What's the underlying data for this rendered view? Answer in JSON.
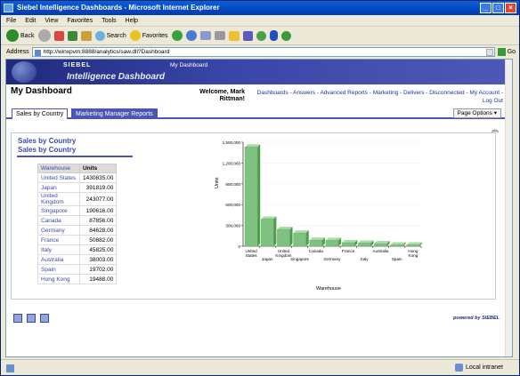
{
  "window": {
    "title": "Siebel Intelligence Dashboards - Microsoft Internet Explorer"
  },
  "menu": [
    "File",
    "Edit",
    "View",
    "Favorites",
    "Tools",
    "Help"
  ],
  "toolbar": {
    "back": "Back",
    "search": "Search",
    "favorites": "Favorites"
  },
  "address": {
    "label": "Address",
    "url": "http://winxpvm:8888/analytics/saw.dll?Dashboard",
    "go": "Go"
  },
  "banner": {
    "brand": "SIEBEL",
    "product": "Intelligence Dashboard",
    "link": "My Dashboard"
  },
  "header": {
    "title": "My Dashboard",
    "welcome_line1": "Welcome, Mark",
    "welcome_line2": "Rittman!",
    "nav_line1": "Dashboards - Answers - Advanced Reports - Marketing - Delivers - Disconnected - My Account -",
    "nav_line2": "Log Out"
  },
  "tabs": [
    "Sales by Country",
    "Marketing Manager Reports"
  ],
  "page_options": "Page Options",
  "report": {
    "title1": "Sales by Country",
    "title2": "Sales by Country",
    "table": {
      "headers": [
        "Warehouse",
        "Units"
      ],
      "rows": [
        [
          "United States",
          "1430835.00"
        ],
        [
          "Japan",
          "391819.00"
        ],
        [
          "United Kingdom",
          "243077.00"
        ],
        [
          "Singapore",
          "190616.00"
        ],
        [
          "Canada",
          "87856.00"
        ],
        [
          "Germany",
          "84628.00"
        ],
        [
          "France",
          "50882.00"
        ],
        [
          "Italy",
          "45825.00"
        ],
        [
          "Australia",
          "38003.00"
        ],
        [
          "Spain",
          "19702.00"
        ],
        [
          "Hong Kong",
          "19488.00"
        ]
      ]
    }
  },
  "chart_data": {
    "type": "bar",
    "categories": [
      "United States",
      "Japan",
      "United Kingdom",
      "Singapore",
      "Canada",
      "Germany",
      "France",
      "Italy",
      "Australia",
      "Spain",
      "Hong Kong"
    ],
    "values": [
      1430835,
      391819,
      243077,
      190616,
      87856,
      84628,
      50882,
      45825,
      38003,
      19702,
      19488
    ],
    "ylim": [
      0,
      1500000
    ],
    "yticks": [
      "0",
      "300,000",
      "600,000",
      "900,000",
      "1,200,000",
      "1,500,000"
    ],
    "xlabel": "Warehouse",
    "ylabel": "Units",
    "bar_color": "#7fc27f",
    "grid": true
  },
  "footer": {
    "powered": "powered by SIEBEL"
  },
  "status": {
    "zone": "Local intranet"
  }
}
